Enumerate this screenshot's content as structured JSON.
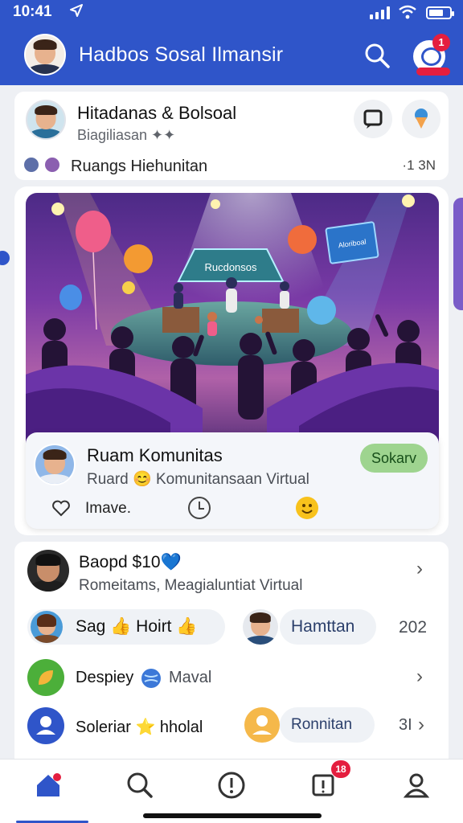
{
  "status_bar": {
    "time": "10:41",
    "location_icon": "navigation-arrow-icon"
  },
  "header": {
    "title": "Hadbos Sosal Ilmansir",
    "notification_count": "1"
  },
  "top_post": {
    "name": "Hitadanas & Bolsoal",
    "subtitle": "Biagiliasan ✦✦",
    "room": "Ruangs Hiehunitan",
    "count": "·1 3N"
  },
  "main_card": {
    "scene_banner": "Rucdonsos",
    "scene_screen": "Aloriboal",
    "title": "Ruam Komunitas",
    "subtitle": "Ruard 😊 Komunitansaan Virtual",
    "join_label": "Sokarv",
    "like_label": "Imave."
  },
  "list": {
    "row1": {
      "name": "Baopd $10💙",
      "subtitle": "Romeitams, Meagialuntiat Virtual"
    },
    "row2": {
      "left_label": "Sag 👍 Hoirt 👍",
      "right_label": "Hamttan",
      "value": "202"
    },
    "row3": {
      "name": "Despiey",
      "sub": "Maval"
    },
    "row4": {
      "name": "Soleriar ⭐ hholal",
      "right_label": "Ronnitan",
      "value": "3I"
    }
  },
  "bottom_nav": {
    "notification_count": "18"
  },
  "colors": {
    "brand": "#2f55c9",
    "badge": "#e41e3f",
    "join": "#9ed48f"
  }
}
